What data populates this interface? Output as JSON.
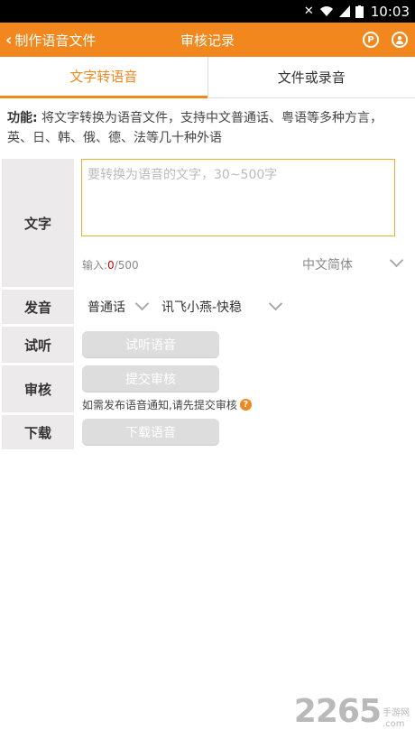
{
  "status": {
    "time": "10:03"
  },
  "appbar": {
    "back_label": "制作语音文件",
    "title": "审核记录"
  },
  "tabs": [
    {
      "label": "文字转语音",
      "active": true
    },
    {
      "label": "文件或录音",
      "active": false
    }
  ],
  "description": {
    "prefix": "功能:",
    "text": " 将文字转换为语音文件，支持中文普通话、粤语等多种方言，英、日、韩、俄、德、法等几十种外语"
  },
  "text_section": {
    "label": "文字",
    "placeholder": "要转换为语音的文字，30~500字",
    "counter_prefix": "输入:",
    "counter_value": "0",
    "counter_max": "/500",
    "language": "中文简体"
  },
  "voice_section": {
    "label": "发音",
    "dialect": "普通话",
    "speaker": "讯飞小燕-快稳"
  },
  "preview_section": {
    "label": "试听",
    "button": "试听语音"
  },
  "review_section": {
    "label": "审核",
    "button": "提交审核",
    "note": "如需发布语音通知,请先提交审核",
    "help_glyph": "?"
  },
  "download_section": {
    "label": "下载",
    "button": "下载语音"
  },
  "watermark": {
    "big": "2265",
    "line1": "手游网",
    "line2": ".com"
  },
  "colors": {
    "accent": "#f2871d",
    "label_bg": "#eceaea",
    "button_bg": "#dddddd"
  }
}
